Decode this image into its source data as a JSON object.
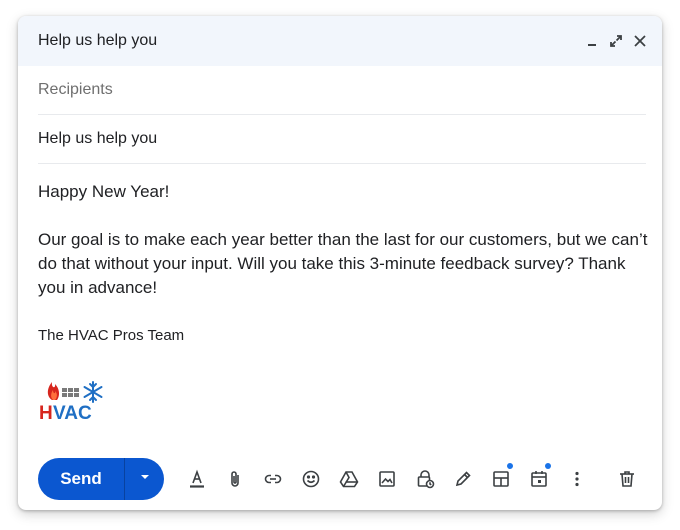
{
  "window": {
    "title": "Help us help you"
  },
  "fields": {
    "recipients_placeholder": "Recipients",
    "subject": "Help us help you"
  },
  "body": {
    "greeting": "Happy New Year!",
    "message": "Our goal is to make each year better than the last for our customers, but we can’t do that without your input. Will you take this 3-minute feedback survey? Thank you in advance!",
    "signature": "The HVAC Pros Team",
    "logo_text": "HVAC"
  },
  "toolbar": {
    "send_label": "Send",
    "icons": [
      "format-text-icon",
      "attach-icon",
      "link-icon",
      "emoji-icon",
      "drive-icon",
      "image-icon",
      "confidential-lock-icon",
      "signature-pen-icon",
      "layout-template-icon",
      "schedule-calendar-icon",
      "more-options-icon",
      "trash-icon"
    ]
  },
  "colors": {
    "send_button": "#0b57d0",
    "titlebar": "#f2f6fc",
    "badge_dot": "#1a73e8",
    "logo_red": "#d7261e",
    "logo_blue": "#1f6fc4"
  }
}
